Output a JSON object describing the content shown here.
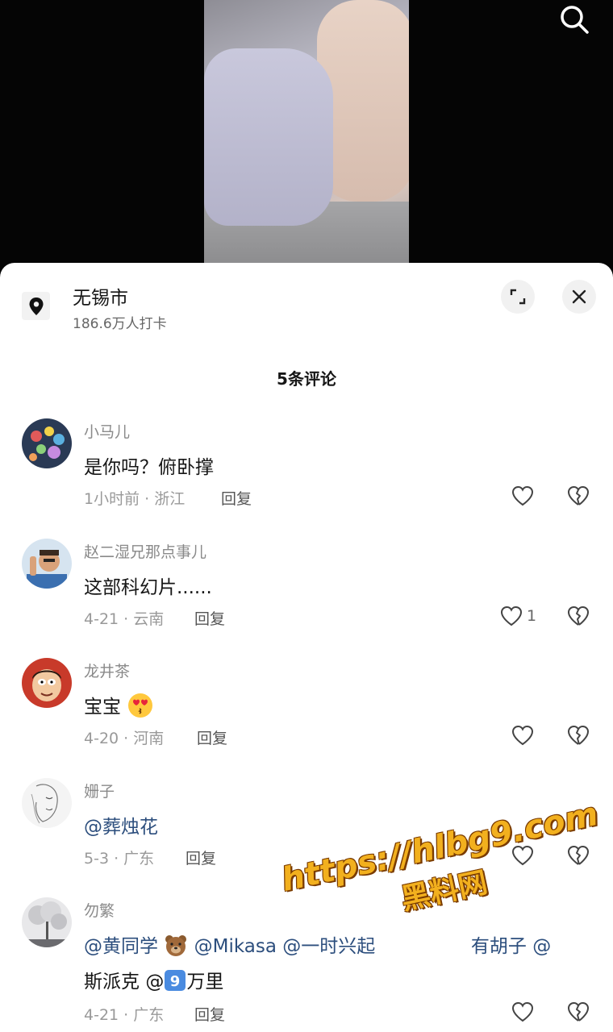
{
  "location": {
    "name": "无锡市",
    "checkins": "186.6万人打卡"
  },
  "comments_header": "5条评论",
  "comments": [
    {
      "user": "小马儿",
      "text": "是你吗？俯卧撑",
      "meta": "1小时前 · 浙江",
      "reply": "回复",
      "likes": ""
    },
    {
      "user": "赵二湿兄那点事儿",
      "text": "这部科幻片......",
      "meta": "4-21 · 云南",
      "reply": "回复",
      "likes": "1"
    },
    {
      "user": "龙井茶",
      "text": "宝宝",
      "meta": "4-20 · 河南",
      "reply": "回复",
      "likes": ""
    },
    {
      "user": "姗子",
      "text": "@葬烛花",
      "meta": "5-3 · 广东",
      "reply": "回复",
      "likes": ""
    },
    {
      "user": "勿繁",
      "text_line1_a": "@黄同学",
      "text_line1_b": "@Mikasa @一时兴起",
      "text_line1_c": "有胡子 @",
      "text_line2_a": "斯派克",
      "text_line2_b": "@",
      "text_line2_c": "万里",
      "meta": "4-21 · 广东",
      "reply": "回复",
      "likes": ""
    }
  ],
  "watermark": {
    "url": "https://hlbg9.com",
    "name": "黑料网"
  },
  "icons": {
    "search": "search-icon",
    "location": "location-pin-icon",
    "expand": "expand-icon",
    "close": "close-icon",
    "like": "heart-outline-icon",
    "dislike": "broken-heart-icon"
  },
  "colors": {
    "mention": "#2c4e7d",
    "watermark": "#f2b01e"
  }
}
